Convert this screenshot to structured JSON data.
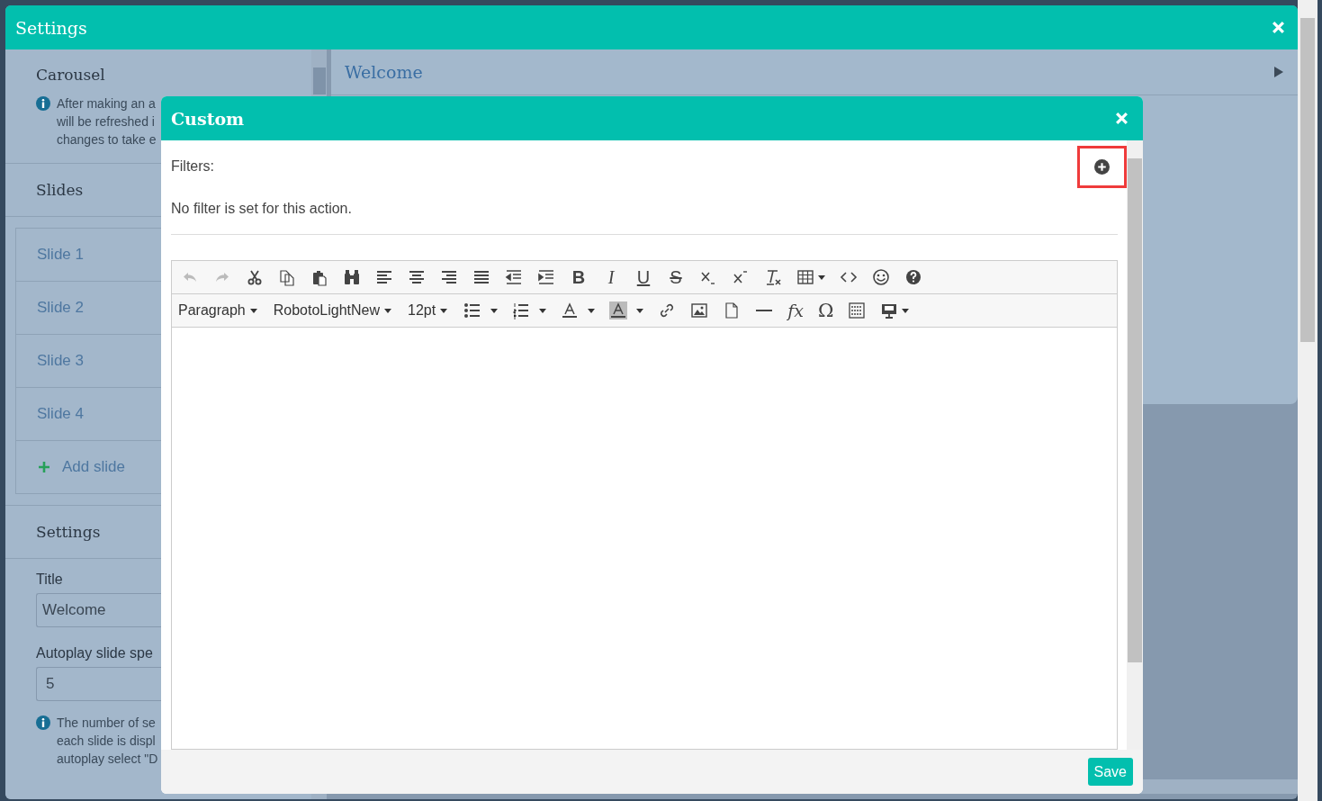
{
  "window": {
    "title": "Settings"
  },
  "carousel": {
    "heading": "Carousel",
    "info": [
      "After making an a",
      "will be refreshed i",
      "changes to take e"
    ]
  },
  "slides": {
    "heading": "Slides",
    "items": [
      {
        "label": "Slide 1"
      },
      {
        "label": "Slide 2"
      },
      {
        "label": "Slide 3"
      },
      {
        "label": "Slide 4"
      }
    ],
    "add_label": "Add slide"
  },
  "settings": {
    "heading": "Settings",
    "title_label": "Title",
    "title_value": "Welcome",
    "speed_label": "Autoplay slide spe",
    "speed_value": "5",
    "info": [
      "The number of se",
      "each slide is displ",
      "autoplay select \"D"
    ]
  },
  "panel": {
    "title": "Welcome"
  },
  "dialog": {
    "title": "Custom",
    "filters_label": "Filters:",
    "filters_empty": "No filter is set for this action.",
    "save_label": "Save"
  },
  "editor": {
    "style_buttons": [
      "B",
      "I",
      "U",
      "S"
    ],
    "dropdowns": [
      "Paragraph",
      "RobotoLightNew",
      "12pt"
    ],
    "symbol_buttons": [
      "fx",
      "Ω"
    ]
  }
}
